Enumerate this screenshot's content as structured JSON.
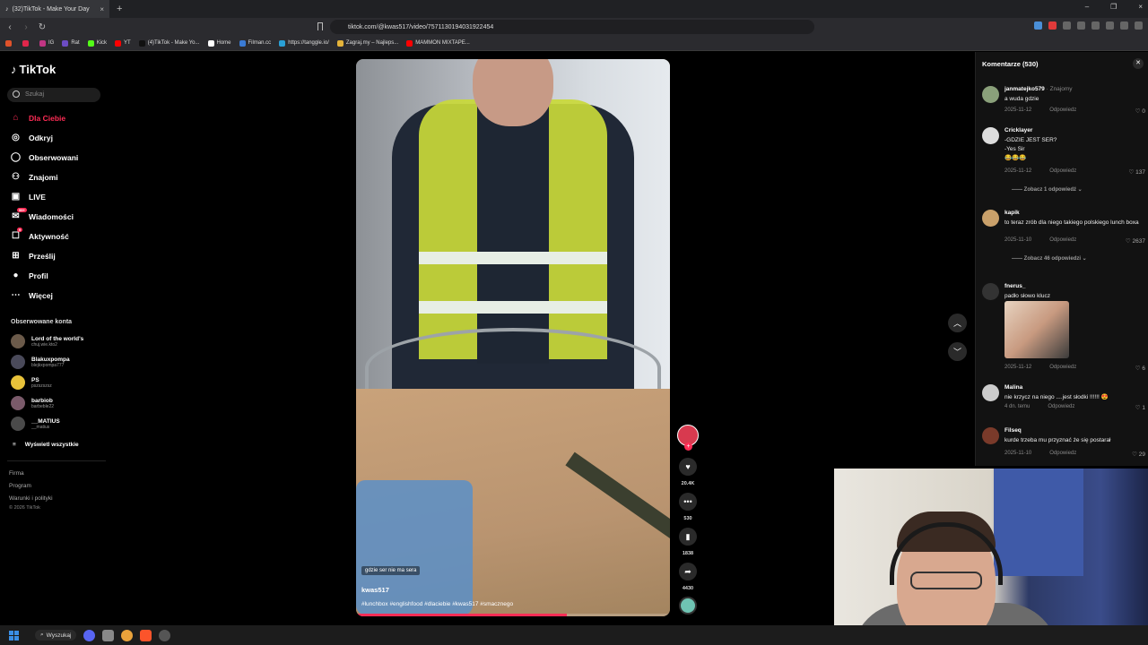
{
  "browser": {
    "tab_title": "(32)TikTok - Make Your Day",
    "tab_close": "×",
    "new_tab": "+",
    "url": "tiktok.com/@kwas517/video/7571130194031922454",
    "window_controls": [
      "–",
      "❐",
      "×"
    ],
    "bookmarks": [
      {
        "label": "",
        "color": "#e0522a"
      },
      {
        "label": "",
        "color": "#e0264b"
      },
      {
        "label": "IG",
        "color": "#c13584"
      },
      {
        "label": "Rat",
        "color": "#6c4cc4"
      },
      {
        "label": "Kick",
        "color": "#53fc18"
      },
      {
        "label": "YT",
        "color": "#ff0000"
      },
      {
        "label": "(4)TikTok - Make Yo...",
        "color": "#111111"
      },
      {
        "label": "Home",
        "color": "#ffffff"
      },
      {
        "label": "Filman.cc",
        "color": "#3a7bd5"
      },
      {
        "label": "https://tanggle.io/",
        "color": "#2aa0d6"
      },
      {
        "label": "Zagraj.my – Najleps...",
        "color": "#e4b33a"
      },
      {
        "label": "MAMMON MIXTAPE...",
        "color": "#ff0000"
      }
    ]
  },
  "sidebar": {
    "logo": "TikTok",
    "search_placeholder": "Szukaj",
    "nav": [
      {
        "label": "Dla Ciebie",
        "icon": "home-icon",
        "active": true
      },
      {
        "label": "Odkryj",
        "icon": "compass-icon"
      },
      {
        "label": "Obserwowani",
        "icon": "following-icon"
      },
      {
        "label": "Znajomi",
        "icon": "friends-icon"
      },
      {
        "label": "LIVE",
        "icon": "live-icon"
      },
      {
        "label": "Wiadomości",
        "icon": "message-icon",
        "badge": "99+"
      },
      {
        "label": "Aktywność",
        "icon": "activity-icon",
        "badge": "9"
      },
      {
        "label": "Prześlij",
        "icon": "upload-icon"
      },
      {
        "label": "Profil",
        "icon": "profile-icon"
      },
      {
        "label": "Więcej",
        "icon": "more-icon"
      }
    ],
    "following_title": "Obserwowane konta",
    "following": [
      {
        "name": "Lord of the world's",
        "handle": "chuj.wie.kto2"
      },
      {
        "name": "Blakuxpompa",
        "handle": "blejkxpompa777"
      },
      {
        "name": "PS",
        "handle": "pszszszsz"
      },
      {
        "name": "barbiob",
        "handle": "barbeble22"
      },
      {
        "name": "__MATIUS",
        "handle": "__matius"
      }
    ],
    "show_all": "Wyświetl wszystkie",
    "footer": [
      "Firma",
      "Program",
      "Warunki i polityki",
      "© 2026 TikTok"
    ]
  },
  "video": {
    "caption_overlay": "gdzie ser nie ma sera",
    "author": "kwas517",
    "hashtags": "#lunchbox #englishfood #dlaciebie #kwas517 #smacznego",
    "progress": 0.67
  },
  "actions": {
    "likes": "20.4K",
    "comments": "530",
    "saves": "1838",
    "shares": "4430"
  },
  "comments": {
    "title": "Komentarze (530)",
    "reply_label": "Odpowiedz",
    "items": [
      {
        "user": "janmatejko579",
        "tag": "· Znajomy",
        "text": "a wuda gdzie",
        "date": "2025-11-12",
        "likes": "0"
      },
      {
        "user": "Cricklayer",
        "tag": "",
        "text": "-GDZIE JEST SER?\n-Yes Sir\n😂😂😂",
        "date": "2025-11-12",
        "likes": "137",
        "replies": "Zobacz 1 odpowiedź"
      },
      {
        "user": "kapik",
        "tag": "",
        "text": "to teraz zrób dla niego takiego polskiego lunch boxa",
        "date": "2025-11-10",
        "likes": "2637",
        "replies": "Zobacz 46 odpowiedzi"
      },
      {
        "user": "fnerus_",
        "tag": "",
        "text": "padło słowo klucz",
        "date": "2025-11-12",
        "likes": "6"
      },
      {
        "user": "Malina",
        "tag": "",
        "text": "nie krzycz na niego ....jest słodki !!!!!! 😍",
        "date": "4 dn. temu",
        "likes": "1"
      },
      {
        "user": "Filseq",
        "tag": "",
        "text": "kurde trzeba mu przyznać że się postarał",
        "date": "2025-11-10",
        "likes": "29"
      }
    ]
  },
  "taskbar": {
    "search": "Wyszukaj"
  }
}
